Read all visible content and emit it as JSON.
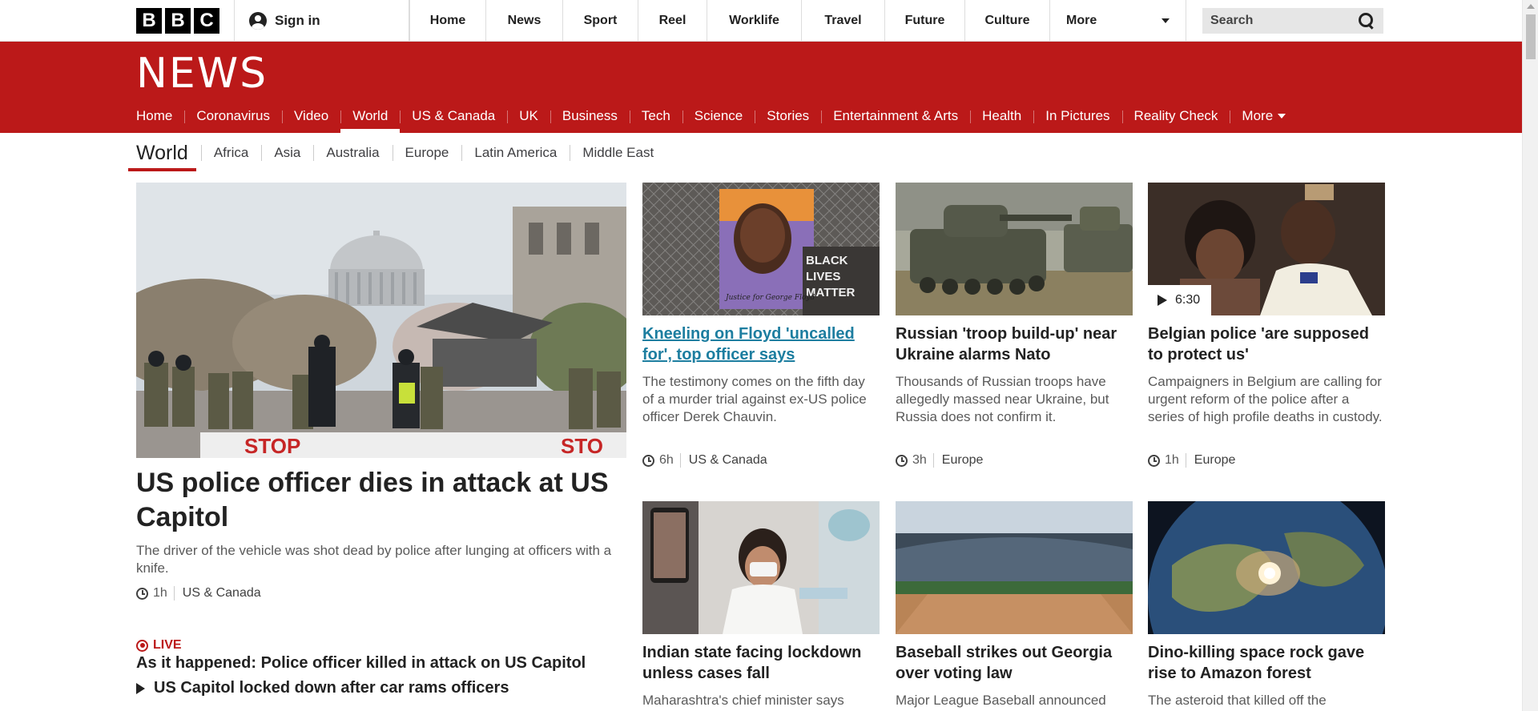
{
  "topbar": {
    "logo_letters": [
      "B",
      "B",
      "C"
    ],
    "signin_label": "Sign in",
    "nav": [
      "Home",
      "News",
      "Sport",
      "Reel",
      "Worklife",
      "Travel",
      "Future",
      "Culture"
    ],
    "more_label": "More",
    "search_placeholder": "Search"
  },
  "news_header": {
    "logo": "NEWS",
    "nav": [
      "Home",
      "Coronavirus",
      "Video",
      "World",
      "US & Canada",
      "UK",
      "Business",
      "Tech",
      "Science",
      "Stories",
      "Entertainment & Arts",
      "Health",
      "In Pictures",
      "Reality Check"
    ],
    "active_item": "World",
    "more_label": "More"
  },
  "subnav": {
    "title": "World",
    "items": [
      "Africa",
      "Asia",
      "Australia",
      "Europe",
      "Latin America",
      "Middle East"
    ]
  },
  "hero": {
    "title": "US police officer dies in attack at US Capitol",
    "summary": "The driver of the vehicle was shot dead by police after lunging at officers with a knife.",
    "time": "1h",
    "section": "US & Canada",
    "image_text": [
      "STOP",
      "STO"
    ]
  },
  "live": {
    "badge": "LIVE",
    "headline": "As it happened: Police officer killed in attack on US Capitol",
    "related": "US Capitol locked down after car rams officers"
  },
  "cards": [
    {
      "title": "Kneeling on Floyd 'uncalled for', top officer says",
      "summary": "The testimony comes on the fifth day of a murder trial against ex-US police officer Derek Chauvin.",
      "time": "6h",
      "section": "US & Canada",
      "image_text": [
        "BLACK",
        "LIVES",
        "MATTER",
        "Justice for George Floyd"
      ]
    },
    {
      "title": "Russian 'troop build-up' near Ukraine alarms Nato",
      "summary": "Thousands of Russian troops have allegedly massed near Ukraine, but Russia does not confirm it.",
      "time": "3h",
      "section": "Europe"
    },
    {
      "title": "Belgian police 'are supposed to protect us'",
      "summary": "Campaigners in Belgium are calling for urgent reform of the police after a series of high profile deaths in custody.",
      "time": "1h",
      "section": "Europe",
      "video_duration": "6:30"
    },
    {
      "title": "Indian state facing lockdown unless cases fall",
      "summary": "Maharashtra's chief minister says"
    },
    {
      "title": "Baseball strikes out Georgia over voting law",
      "summary": "Major League Baseball announced"
    },
    {
      "title": "Dino-killing space rock gave rise to Amazon forest",
      "summary": "The asteroid that killed off the"
    }
  ],
  "colors": {
    "brand_red": "#bb1919",
    "link_blue": "#1d7ea0",
    "text_dark": "#222222",
    "text_muted": "#5a5a5a"
  }
}
